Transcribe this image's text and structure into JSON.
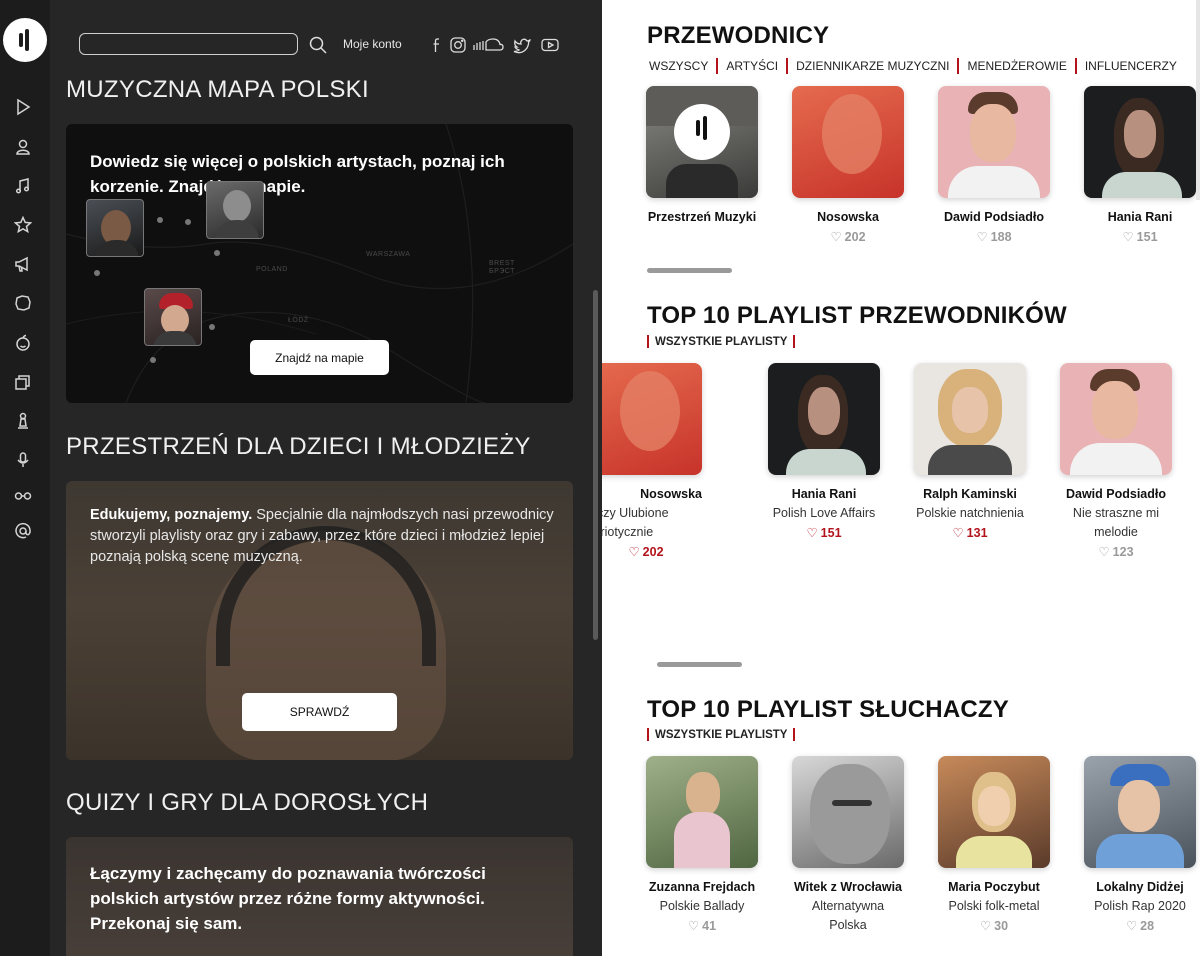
{
  "header": {
    "search_placeholder": "",
    "account_label": "Moje konto",
    "social": [
      "facebook-icon",
      "instagram-icon",
      "soundcloud-icon",
      "twitter-icon",
      "youtube-icon"
    ]
  },
  "sidebar": {
    "icons": [
      "play-icon",
      "person-icon",
      "music-note-icon",
      "star-icon",
      "megaphone-icon",
      "poland-map-icon",
      "apple-icon",
      "books-icon",
      "chess-pawn-icon",
      "microphone-icon",
      "glasses-icon",
      "at-icon"
    ]
  },
  "left": {
    "map_section": {
      "title": "MUZYCZNA MAPA POLSKI",
      "heading": "Dowiedz się więcej o polskich artystach, poznaj ich korzenie. Znajdź na mapie.",
      "button": "Znajdź na mapie",
      "map_labels": [
        "WARSZAWA",
        "POLAND",
        "ŁÓDŹ",
        "BREST",
        "БРЭСТ"
      ]
    },
    "kids_section": {
      "title": "PRZESTRZEŃ DLA DZIECI I MŁODZIEŻY",
      "lead": "Edukujemy, poznajemy.",
      "text": " Specjalnie dla najmłodszych nasi przewodnicy stworzyli playlisty oraz gry i zabawy, przez które dzieci i młodzież lepiej poznają polską scenę muzyczną.",
      "button": "SPRAWDŹ"
    },
    "quiz_section": {
      "title": "QUIZY I GRY DLA DOROSŁYCH",
      "heading": "Łączymy i zachęcamy do poznawania twórczości polskich artystów przez różne formy aktywności. Przekonaj się sam."
    }
  },
  "right": {
    "guides": {
      "title": "PRZEWODNICY",
      "filters": [
        "WSZYSCY",
        "ARTYŚCI",
        "DZIENNIKARZE MUZYCZNI",
        "MENEDŻEROWIE",
        "INFLUENCERZY"
      ],
      "items": [
        {
          "name": "Przestrzeń Muzyki",
          "likes": ""
        },
        {
          "name": "Nosowska",
          "likes": "202"
        },
        {
          "name": "Dawid Podsiadło",
          "likes": "188"
        },
        {
          "name": "Hania Rani",
          "likes": "151"
        }
      ]
    },
    "top_guides": {
      "title": "TOP 10 PLAYLIST PRZEWODNIKÓW",
      "link": "WSZYSTKIE PLAYLISTY",
      "items": [
        {
          "name": "Nosowska",
          "sub": "eczy Ulubione atriotycznie",
          "likes": "202",
          "liked": true
        },
        {
          "name": "Hania Rani",
          "sub": "Polish Love Affairs",
          "likes": "151",
          "liked": true
        },
        {
          "name": "Ralph Kaminski",
          "sub": "Polskie natchnienia",
          "likes": "131",
          "liked": true
        },
        {
          "name": "Dawid Podsiadło",
          "sub": "Nie straszne mi melodie",
          "likes": "123",
          "liked": false
        }
      ]
    },
    "top_listeners": {
      "title": "TOP 10 PLAYLIST SŁUCHACZY",
      "link": "WSZYSTKIE PLAYLISTY",
      "items": [
        {
          "name": "Zuzanna Frejdach",
          "sub": "Polskie Ballady",
          "likes": "41"
        },
        {
          "name": "Witek z Wrocławia",
          "sub": "Alternatywna Polska",
          "likes": ""
        },
        {
          "name": "Maria Poczybut",
          "sub": "Polski folk-metal",
          "likes": "30"
        },
        {
          "name": "Lokalny Didżej",
          "sub": "Polish Rap 2020",
          "likes": "28"
        }
      ]
    }
  },
  "heart_glyph": "♡",
  "colors": {
    "accent": "#b3141c",
    "dark_bg": "#262626",
    "rail_bg": "#1c1c1c"
  }
}
